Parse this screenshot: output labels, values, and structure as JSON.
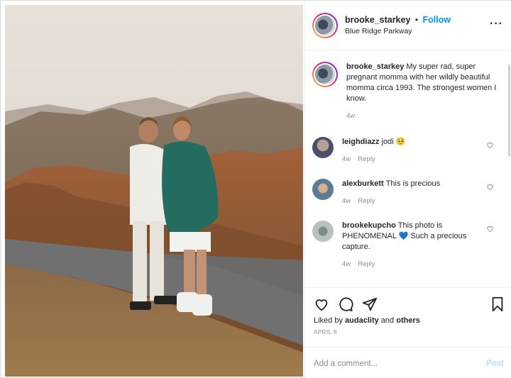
{
  "post": {
    "username": "brooke_starkey",
    "separator": "•",
    "follow_label": "Follow",
    "location": "Blue Ridge Parkway",
    "more_label": "···"
  },
  "caption": {
    "username": "brooke_starkey",
    "text": "My super rad, super pregnant momma with her wildly beautiful momma circa 1993. The strongest women I know.",
    "time": "4w"
  },
  "comments": [
    {
      "username": "leighdiazz",
      "text": "jodi 🥺",
      "time": "4w",
      "reply": "Reply"
    },
    {
      "username": "alexburkett",
      "text": "This is precious",
      "time": "4w",
      "reply": "Reply"
    },
    {
      "username": "brookekupcho",
      "text": "This photo is PHENOMENAL 💙 Such a precious capture.",
      "time": "4w",
      "reply": "Reply"
    }
  ],
  "likes": {
    "prefix": "Liked by",
    "user": "audaclity",
    "middle": "and",
    "others": "others"
  },
  "date": "APRIL 8",
  "add_comment": {
    "placeholder": "Add a comment...",
    "post_label": "Post"
  },
  "colors": {
    "follow": "#0095f6",
    "post_disabled": "#b2dffc",
    "muted": "#8e8e8e"
  }
}
